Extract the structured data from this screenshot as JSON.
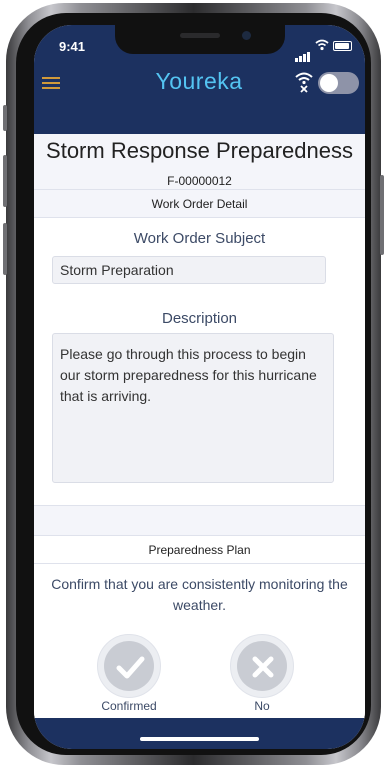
{
  "status_bar": {
    "time": "9:41"
  },
  "app_header": {
    "logo": "Youreka",
    "menu_icon": "hamburger-menu-icon",
    "offline_icon": "wifi-off-icon",
    "sync_toggle_on": false
  },
  "form": {
    "title": "Storm Response Preparedness",
    "id": "F-00000012"
  },
  "work_order_section": {
    "heading": "Work Order Detail",
    "subject_label": "Work Order Subject",
    "subject_value": "Storm Preparation",
    "description_label": "Description",
    "description_value": "Please go through this process to begin our storm preparedness for this hurricane that is arriving."
  },
  "plan_section": {
    "heading": "Preparedness Plan",
    "question": "Confirm that you are consistently monitoring the weather.",
    "options": [
      {
        "label": "Confirmed",
        "icon": "checkmark-icon"
      },
      {
        "label": "No",
        "icon": "x-icon"
      }
    ]
  },
  "colors": {
    "header": "#1c3160",
    "logo": "#54c4f2",
    "menu": "#d19a3a",
    "label_text": "#3c4a66"
  }
}
